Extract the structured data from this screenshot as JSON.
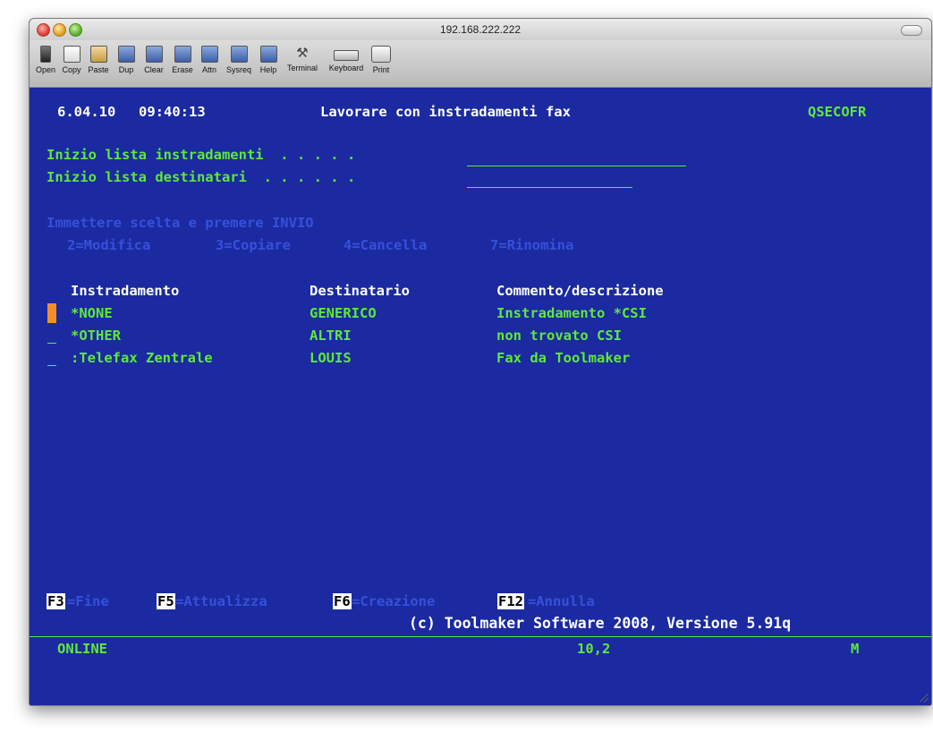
{
  "window": {
    "title": "192.168.222.222"
  },
  "toolbar": {
    "buttons": [
      {
        "label": "Open",
        "icon": "plug-icon"
      },
      {
        "label": "Copy",
        "icon": "copy-icon"
      },
      {
        "label": "Paste",
        "icon": "paste-icon"
      },
      {
        "label": "Dup",
        "icon": "dup-key-icon"
      },
      {
        "label": "Clear",
        "icon": "clear-key-icon"
      },
      {
        "label": "Erase",
        "icon": "erase-key-icon"
      },
      {
        "label": "Attn",
        "icon": "attn-key-icon"
      },
      {
        "label": "Sysreq",
        "icon": "sysreq-key-icon"
      },
      {
        "label": "Help",
        "icon": "help-key-icon"
      },
      {
        "label": "Terminal",
        "icon": "hammer-icon"
      },
      {
        "label": "Keyboard",
        "icon": "keyboard-icon"
      },
      {
        "label": "Print",
        "icon": "printer-icon"
      }
    ]
  },
  "screen": {
    "date": "6.04.10",
    "time": "09:40:13",
    "title": "Lavorare con instradamenti fax",
    "user": "QSECOFR",
    "prompt_routes": "Inizio lista instradamenti  . . . . .",
    "prompt_recipients": "Inizio lista destinatari  . . . . . .",
    "instructions": "Immettere scelta e premere INVIO",
    "options": [
      "2=Modifica",
      "3=Copiare",
      "4=Cancella",
      "7=Rinomina"
    ],
    "headers": {
      "route": "Instradamento",
      "recipient": "Destinatario",
      "comment": "Commento/descrizione"
    },
    "rows": [
      {
        "route": "*NONE",
        "recipient": "GENERICO",
        "comment": "Instradamento *CSI"
      },
      {
        "route": "*OTHER",
        "recipient": "ALTRI",
        "comment": "non trovato CSI"
      },
      {
        "route": ":Telefax Zentrale",
        "recipient": "LOUIS",
        "comment": "Fax da Toolmaker"
      }
    ],
    "fkeys": [
      {
        "key": "F3",
        "label": "=Fine"
      },
      {
        "key": "F5",
        "label": "=Attualizza"
      },
      {
        "key": "F6",
        "label": "=Creazione"
      },
      {
        "key": "F12",
        "label": "=Annulla"
      }
    ],
    "copyright": "(c) Toolmaker Software 2008, Versione 5.91q",
    "status": {
      "mode": "ONLINE",
      "cursor_pos": "10,2",
      "indicator": "M"
    }
  },
  "colors": {
    "background": "#1b2aa0",
    "text_white": "#ffffff",
    "text_green": "#5fe83a",
    "text_dim": "#3650dc",
    "cursor": "#f28e2a"
  }
}
